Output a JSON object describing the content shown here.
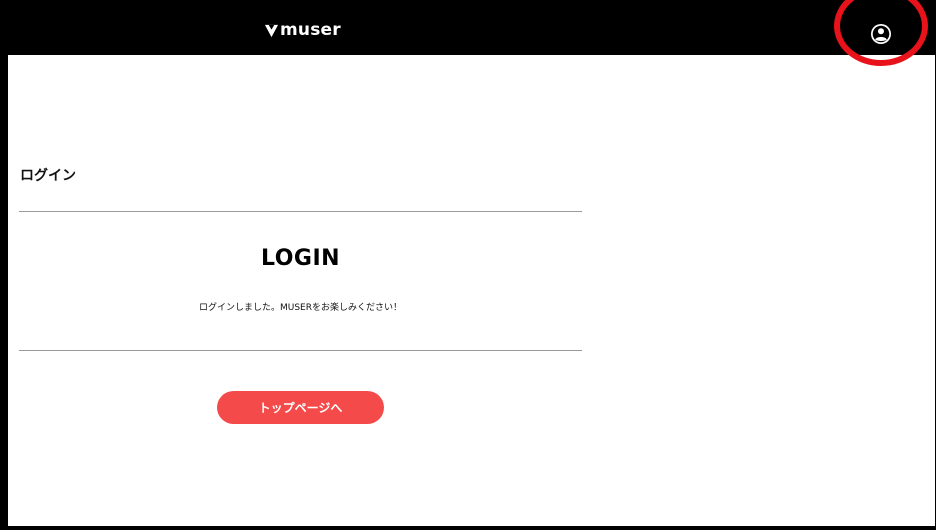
{
  "header": {
    "brand_text": "muser",
    "brand_icon": "muser-logo-icon",
    "account_icon": "user-account-icon",
    "background": "#000000",
    "highlight_color": "#e8121b"
  },
  "main": {
    "page_heading": "ログイン",
    "title": "LOGIN",
    "message": "ログインしました。MUSERをお楽しみください！",
    "top_page_button_label": "トップページへ",
    "button_color": "#f44a4a"
  }
}
